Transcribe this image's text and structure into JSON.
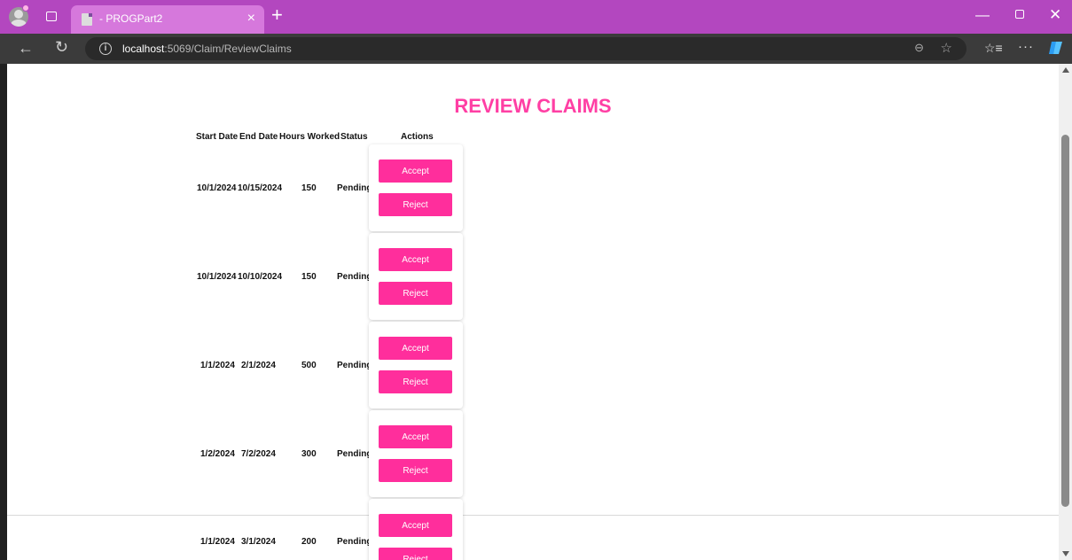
{
  "browser": {
    "tab_title": "- PROGPart2",
    "tab_close": "×",
    "new_tab": "+",
    "url_host": "localhost",
    "url_path": ":5069/Claim/ReviewClaims",
    "icons": [
      "profile-icon",
      "tabs-icon",
      "close-icon",
      "plus-icon",
      "back-icon",
      "reload-icon",
      "info-icon",
      "zoom-icon",
      "favorite-icon",
      "favorites-icon",
      "more-icon",
      "copilot-icon",
      "minimize-icon",
      "restore-icon",
      "close-window-icon"
    ],
    "accent_color": "#b347bf"
  },
  "page": {
    "title": "REVIEW CLAIMS",
    "title_color": "#ff3fa4",
    "button_color": "#ff2e9c"
  },
  "table": {
    "headers": [
      "Start Date",
      "End Date",
      "Hours Worked",
      "Status",
      "Actions"
    ],
    "rows": [
      {
        "start": "10/1/2024",
        "end": "10/15/2024",
        "hours": "150",
        "status": "Pending",
        "accept": "Accept",
        "reject": "Reject"
      },
      {
        "start": "10/1/2024",
        "end": "10/10/2024",
        "hours": "150",
        "status": "Pending",
        "accept": "Accept",
        "reject": "Reject"
      },
      {
        "start": "1/1/2024",
        "end": "2/1/2024",
        "hours": "500",
        "status": "Pending",
        "accept": "Accept",
        "reject": "Reject"
      },
      {
        "start": "1/2/2024",
        "end": "7/2/2024",
        "hours": "300",
        "status": "Pending",
        "accept": "Accept",
        "reject": "Reject"
      },
      {
        "start": "1/1/2024",
        "end": "3/1/2024",
        "hours": "200",
        "status": "Pending",
        "accept": "Accept",
        "reject": "Reject"
      }
    ]
  }
}
